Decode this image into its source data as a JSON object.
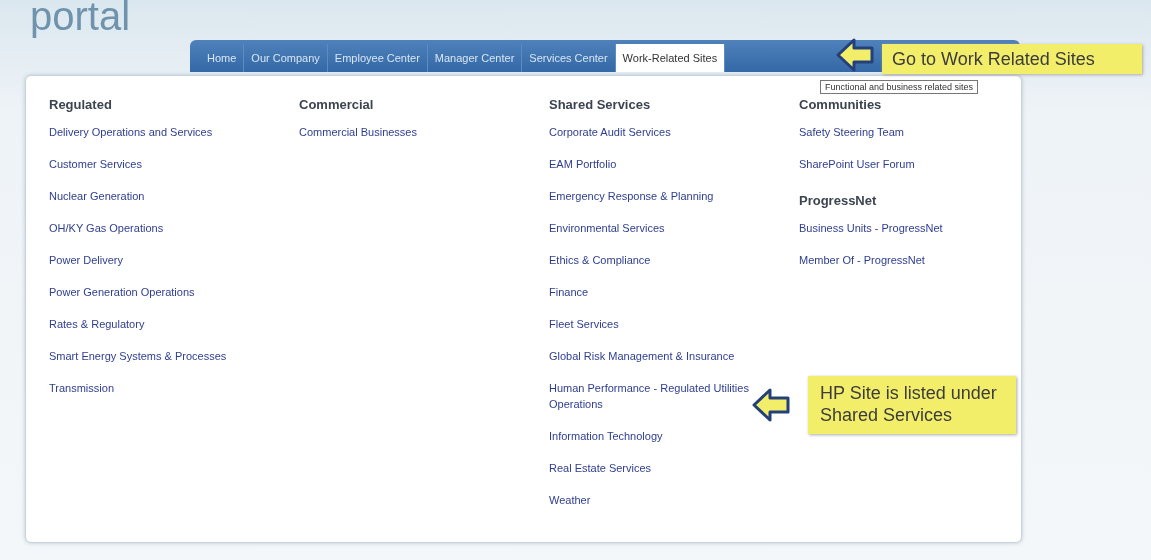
{
  "logo": "portal",
  "nav": [
    {
      "label": "Home",
      "selected": false
    },
    {
      "label": "Our Company",
      "selected": false
    },
    {
      "label": "Employee Center",
      "selected": false
    },
    {
      "label": "Manager Center",
      "selected": false
    },
    {
      "label": "Services Center",
      "selected": false
    },
    {
      "label": "Work-Related Sites",
      "selected": true
    }
  ],
  "tooltip": "Functional and business related sites",
  "columns": [
    {
      "groups": [
        {
          "heading": "Regulated",
          "items": [
            "Delivery Operations and Services",
            "Customer Services",
            "Nuclear Generation",
            "OH/KY Gas Operations",
            "Power Delivery",
            "Power Generation Operations",
            "Rates & Regulatory",
            "Smart Energy Systems & Processes",
            "Transmission"
          ]
        }
      ]
    },
    {
      "groups": [
        {
          "heading": "Commercial",
          "items": [
            "Commercial Businesses"
          ]
        }
      ]
    },
    {
      "groups": [
        {
          "heading": "Shared Services",
          "items": [
            "Corporate Audit Services",
            "EAM Portfolio",
            "Emergency Response & Planning",
            "Environmental Services",
            "Ethics & Compliance",
            "Finance",
            "Fleet Services",
            "Global Risk Management & Insurance",
            "Human Performance - Regulated Utilities Operations",
            "Information Technology",
            "Real Estate Services",
            "Weather"
          ]
        }
      ]
    },
    {
      "groups": [
        {
          "heading": "Communities",
          "items": [
            "Safety Steering Team",
            "SharePoint User Forum"
          ]
        },
        {
          "heading": "ProgressNet",
          "items": [
            "Business Units - ProgressNet",
            "Member Of - ProgressNet"
          ]
        }
      ]
    }
  ],
  "callouts": [
    {
      "text": "Go to Work Related Sites"
    },
    {
      "text": "HP Site is listed under Shared Services"
    }
  ]
}
